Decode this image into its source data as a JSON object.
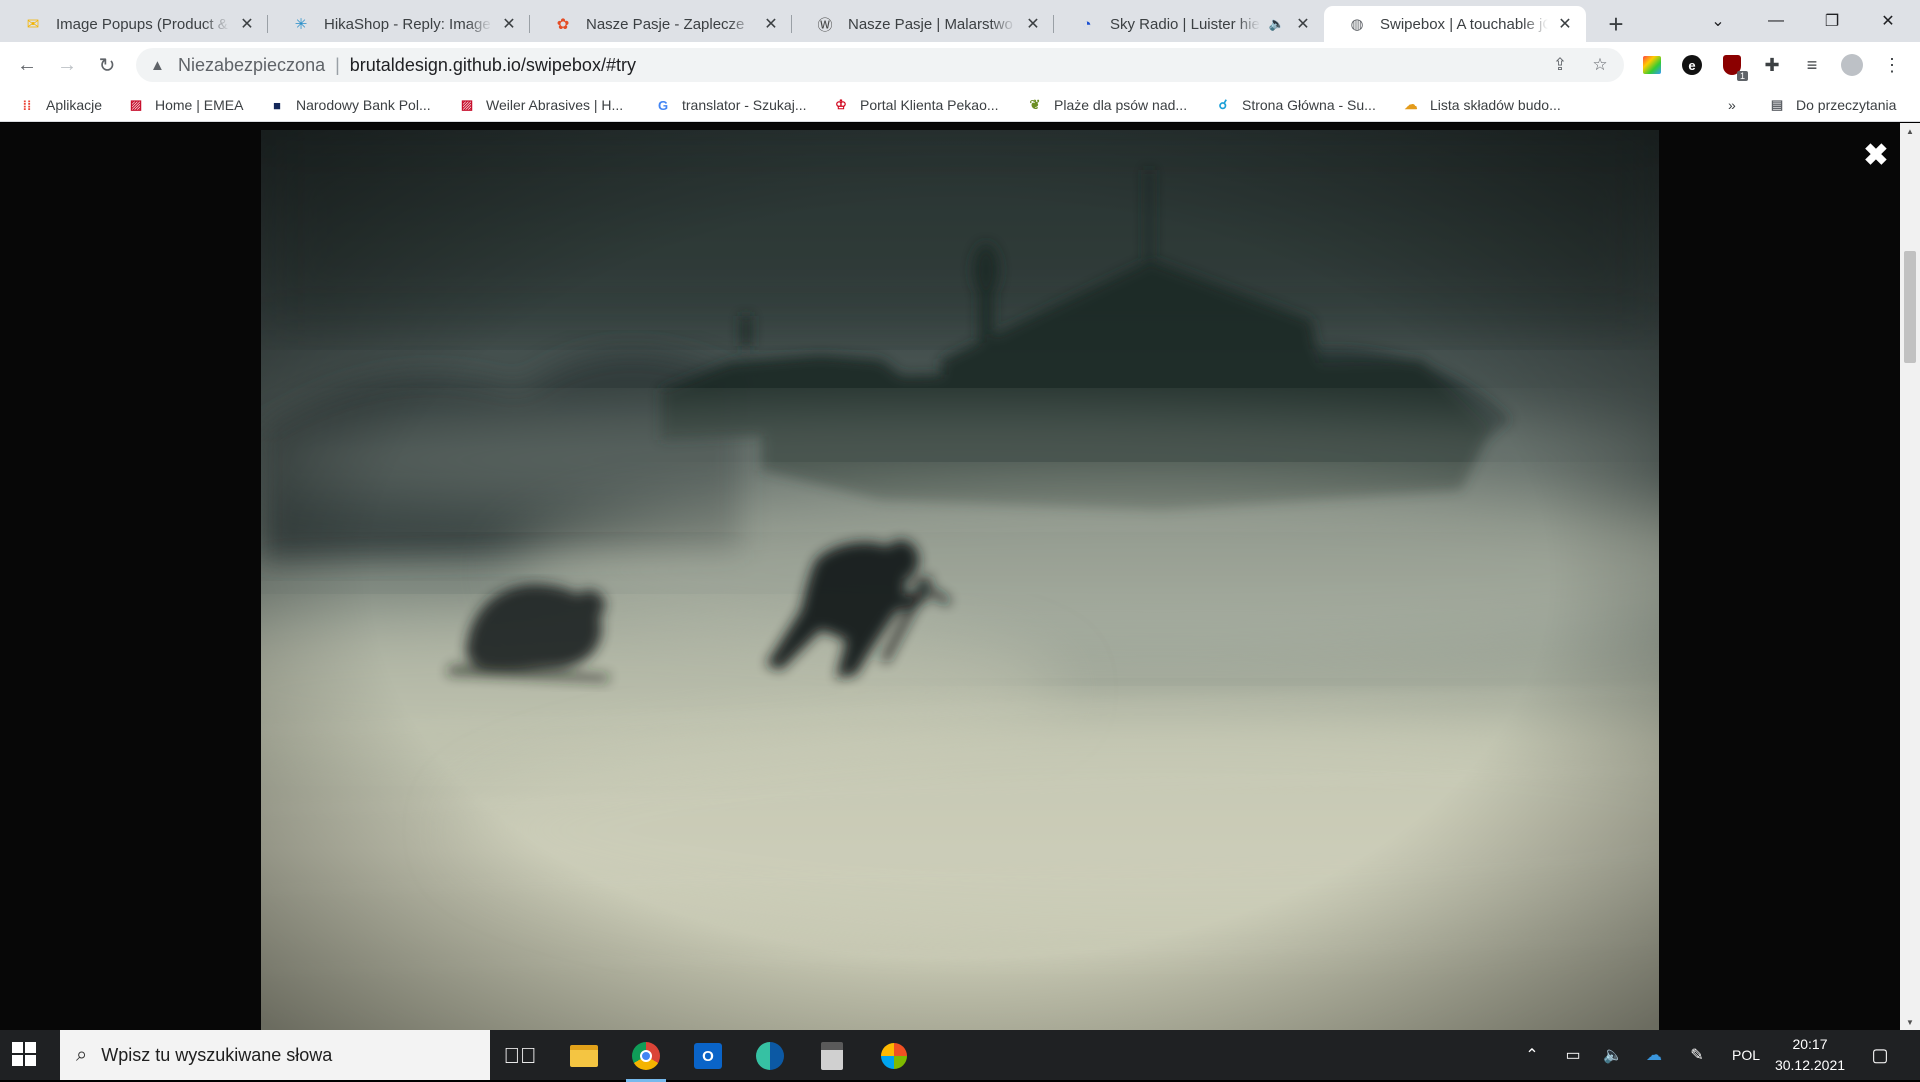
{
  "browser": {
    "tabs": [
      {
        "title": "Image Popups (Product & C",
        "icon": "mail-icon",
        "active": false
      },
      {
        "title": "HikaShop - Reply: Image Po",
        "icon": "hikashop-icon",
        "active": false
      },
      {
        "title": "Nasze Pasje - Zaplecze",
        "icon": "joomla-icon",
        "active": false
      },
      {
        "title": "Nasze Pasje | Malarstwo i R",
        "icon": "wordpress-icon",
        "active": false
      },
      {
        "title": "Sky Radio | Luister hier",
        "icon": "sky-radio-icon",
        "active": false,
        "audio": true
      },
      {
        "title": "Swipebox | A touchable jQu",
        "icon": "globe-icon",
        "active": true
      }
    ],
    "address": {
      "security_label": "Niezabezpieczona",
      "url": "brutaldesign.github.io/swipebox/#try"
    },
    "bookmarks": [
      {
        "label": "Aplikacje",
        "icon": "apps-grid-icon"
      },
      {
        "label": "Home | EMEA",
        "icon": "bookmark-emea-icon"
      },
      {
        "label": "Narodowy Bank Pol...",
        "icon": "nbp-icon"
      },
      {
        "label": "Weiler Abrasives | H...",
        "icon": "weiler-icon"
      },
      {
        "label": "translator - Szukaj...",
        "icon": "google-icon"
      },
      {
        "label": "Portal Klienta Pekao...",
        "icon": "pekao-icon"
      },
      {
        "label": "Plaże dla psów nad...",
        "icon": "dog-beach-icon"
      },
      {
        "label": "Strona Główna - Su...",
        "icon": "strona-icon"
      },
      {
        "label": "Lista składów budo...",
        "icon": "lista-icon"
      }
    ],
    "reading_list_label": "Do przeczytania",
    "extension_badge": "1"
  },
  "lightbox": {
    "close_glyph": "✖"
  },
  "taskbar": {
    "search_placeholder": "Wpisz tu wyszukiwane słowa",
    "language": "POL",
    "time": "20:17",
    "date": "30.12.2021"
  },
  "colors": {
    "tabstrip_bg": "#dee1e6",
    "taskbar_bg": "#1f2123",
    "lightbox_bg": "#070707"
  }
}
